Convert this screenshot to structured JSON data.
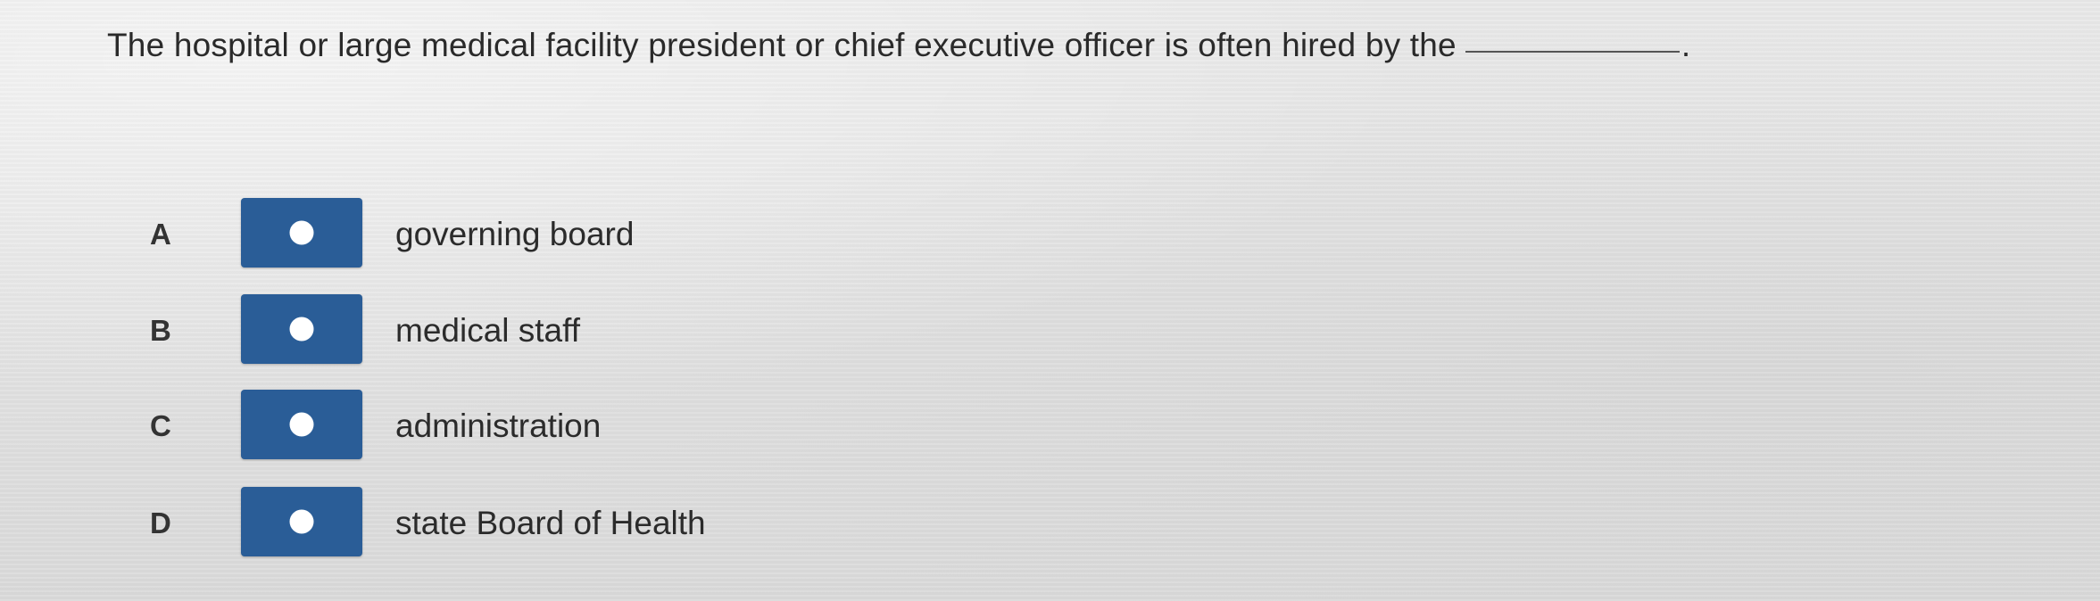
{
  "question": {
    "text": "The hospital or large medical facility president or chief executive officer is often hired by the",
    "period": "."
  },
  "options": [
    {
      "letter": "A",
      "text": "governing board"
    },
    {
      "letter": "B",
      "text": "medical staff"
    },
    {
      "letter": "C",
      "text": "administration"
    },
    {
      "letter": "D",
      "text": "state Board of Health"
    }
  ],
  "colors": {
    "button": "#2a5d97",
    "dot": "#ffffff"
  },
  "icons": {
    "option_marker": "radio-dot-icon"
  }
}
